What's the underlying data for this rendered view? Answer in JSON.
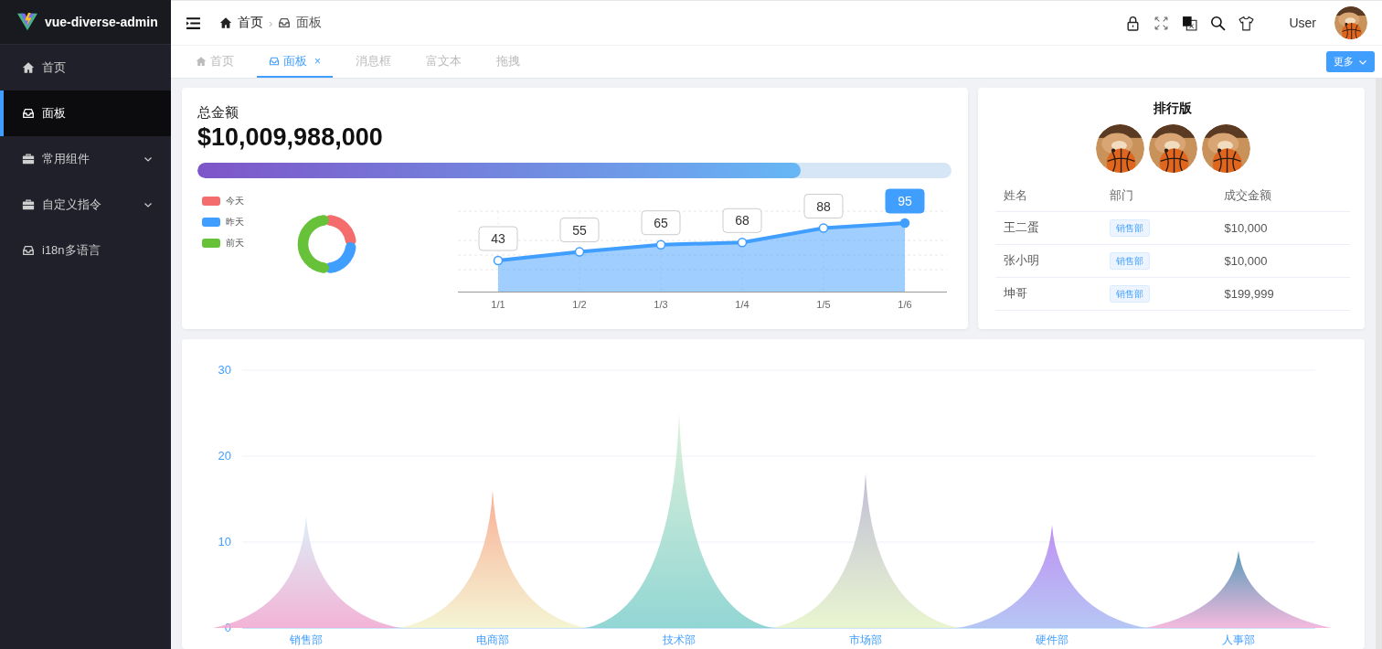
{
  "sidebar": {
    "title": "vue-diverse-admin",
    "items": [
      {
        "label": "首页",
        "selected": false
      },
      {
        "label": "面板",
        "selected": true
      },
      {
        "label": "常用组件",
        "selected": false,
        "expanded": false
      },
      {
        "label": "自定义指令",
        "selected": false,
        "expanded": false
      },
      {
        "label": "i18n多语言",
        "selected": false
      }
    ]
  },
  "header": {
    "breadcrumb": [
      "首页",
      "面板"
    ],
    "separator": "›",
    "user": "User"
  },
  "tabs": [
    {
      "label": "首页",
      "selected": false
    },
    {
      "label": "面板",
      "selected": true,
      "close": "×"
    },
    {
      "label": "消息框",
      "selected": false
    },
    {
      "label": "富文本",
      "selected": false
    },
    {
      "label": "拖拽",
      "selected": false
    }
  ],
  "more_button": "更多",
  "summary": {
    "title": "总金额",
    "amount": "$10,009,988,000",
    "progress": {
      "level": 0.8
    },
    "legend": [
      {
        "label": "今天",
        "color": "#f56c6c"
      },
      {
        "label": "昨天",
        "color": "#409eff"
      },
      {
        "label": "前天",
        "color": "#67c23a"
      }
    ],
    "chart_data": {
      "type": "area",
      "categories": [
        "1/1",
        "1/2",
        "1/3",
        "1/4",
        "1/5",
        "1/6"
      ],
      "series": [
        {
          "color": "#409eff",
          "values": [
            43,
            55,
            65,
            68,
            88,
            95
          ]
        }
      ],
      "data_labels": true,
      "grid": true
    }
  },
  "ranking": {
    "title": "排行版",
    "avatars": [
      {
        "kind": "picture"
      },
      {
        "kind": "picture"
      },
      {
        "kind": "picture"
      }
    ],
    "columns": [
      "姓名",
      "部门",
      "成交金额"
    ],
    "rows": [
      {
        "name": "王二蛋",
        "department": "销售部",
        "amount": "$10,000"
      },
      {
        "name": "张小明",
        "department": "销售部",
        "amount": "$10,000"
      },
      {
        "name": "坤哥",
        "department": "销售部",
        "amount": "$199,999"
      }
    ]
  },
  "department_chart": {
    "chart_data": {
      "type": "area",
      "categories": [
        "销售部",
        "电商部",
        "技术部",
        "市场部",
        "硬件部",
        "人事部"
      ],
      "series": [
        {
          "values": [
            13,
            16,
            25,
            18,
            12,
            9
          ]
        }
      ],
      "ylim": [
        0,
        30
      ],
      "yticks": [
        0,
        10,
        20,
        30
      ]
    }
  }
}
